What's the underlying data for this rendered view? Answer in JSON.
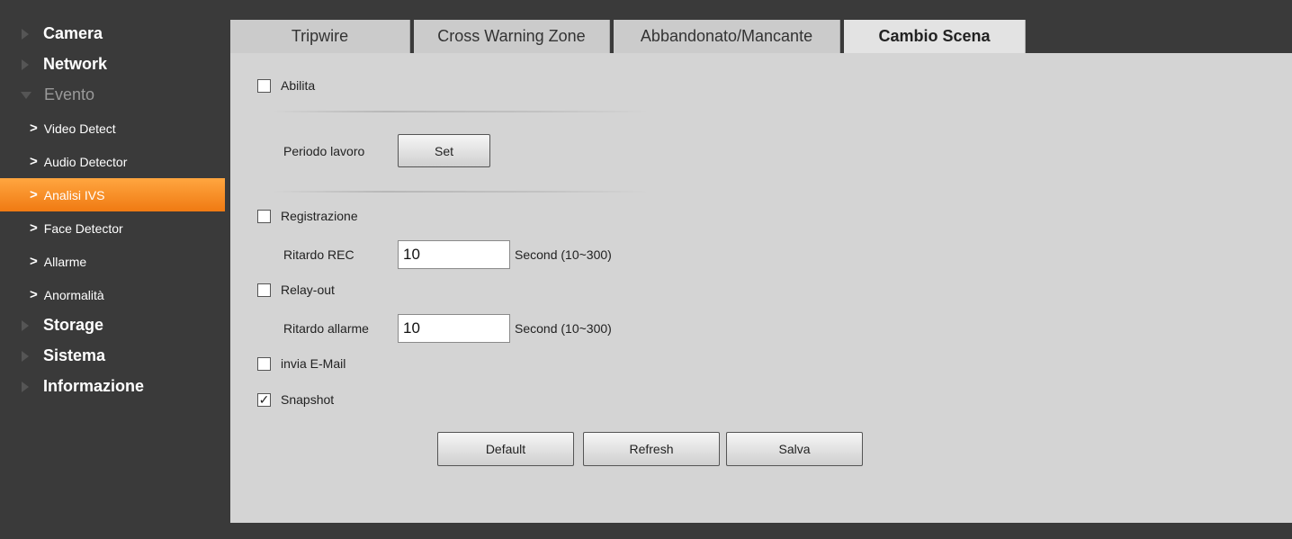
{
  "sidebar": {
    "camera": "Camera",
    "network": "Network",
    "evento": "Evento",
    "sub": [
      "Video Detect",
      "Audio Detector",
      "Analisi IVS",
      "Face Detector",
      "Allarme",
      "Anormalità"
    ],
    "storage": "Storage",
    "sistema": "Sistema",
    "informazione": "Informazione",
    "active_color": "#f07a12"
  },
  "tabs": [
    "Tripwire",
    "Cross Warning Zone",
    "Abbandonato/Mancante",
    "Cambio Scena"
  ],
  "form": {
    "enable_label": "Abilita",
    "enable_checked": false,
    "period_label": "Periodo lavoro",
    "set_button": "Set",
    "record_label": "Registrazione",
    "record_checked": false,
    "rec_delay_label": "Ritardo REC",
    "rec_delay_value": "10",
    "rec_delay_unit": "Second (10~300)",
    "relay_label": "Relay-out",
    "relay_checked": false,
    "alarm_delay_label": "Ritardo allarme",
    "alarm_delay_value": "10",
    "alarm_delay_unit": "Second (10~300)",
    "email_label": "invia E-Mail",
    "email_checked": false,
    "snapshot_label": "Snapshot",
    "snapshot_checked": true,
    "check_mark": "✓"
  },
  "footer": {
    "default_button": "Default",
    "refresh_button": "Refresh",
    "save_button": "Salva"
  }
}
